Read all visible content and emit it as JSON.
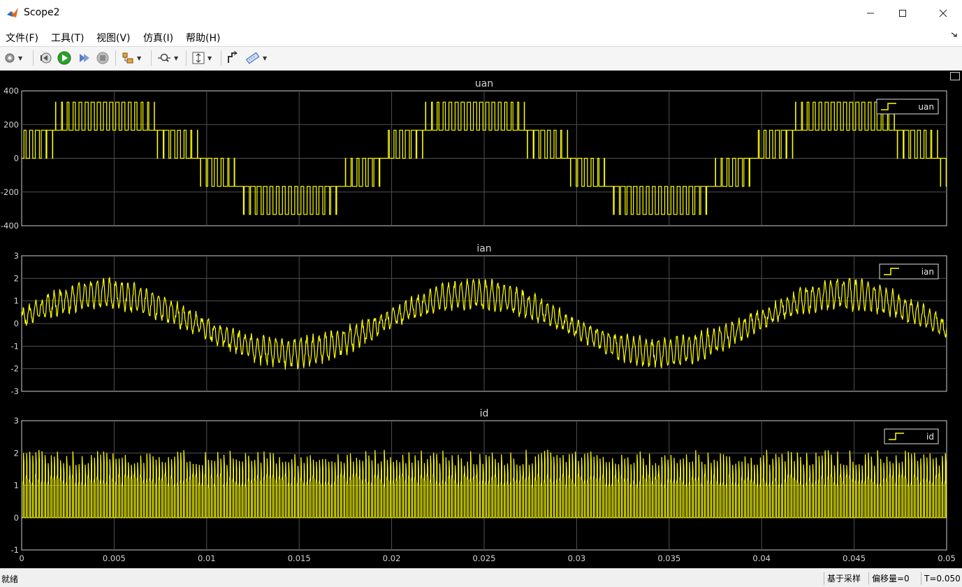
{
  "window": {
    "title": "Scope2",
    "minimize_icon": "minimize-icon",
    "maximize_icon": "maximize-icon",
    "close_icon": "close-icon"
  },
  "menu": {
    "items": [
      "文件(F)",
      "工具(T)",
      "视图(V)",
      "仿真(I)",
      "帮助(H)"
    ]
  },
  "toolbar": {
    "icons": [
      "gear-icon",
      "step-back-icon",
      "run-icon",
      "step-forward-icon",
      "stop-icon",
      "signal-select-icon",
      "zoom-icon",
      "autoscale-icon",
      "highlight-block-icon",
      "measure-icon"
    ]
  },
  "status": {
    "ready": "就绪",
    "sample_based": "基于采样",
    "offset": "偏移量=0",
    "time": "T=0.050"
  },
  "chart_data": [
    {
      "type": "line",
      "title": "uan",
      "legend": [
        "uan"
      ],
      "legend_position": "top-right",
      "ylim": [
        -400,
        400
      ],
      "yticks": [
        "400",
        "200",
        "0",
        "-200",
        "-400"
      ],
      "xlim": [
        0,
        0.05
      ],
      "grid": true,
      "series": [
        {
          "name": "uan",
          "color": "#ffff00",
          "description_levels": [
            -333,
            -167,
            0,
            167,
            333
          ],
          "fundamental_frequency_hz": 50,
          "switching_frequency_hz": 3000
        }
      ]
    },
    {
      "type": "line",
      "title": "ian",
      "legend": [
        "ian"
      ],
      "legend_position": "top-right",
      "ylim": [
        -3,
        3
      ],
      "yticks": [
        "3",
        "2",
        "1",
        "0",
        "-1",
        "-2",
        "-3"
      ],
      "xlim": [
        0,
        0.05
      ],
      "grid": true,
      "series": [
        {
          "name": "ian",
          "color": "#ffff00",
          "amplitude": 1.3,
          "ripple": 0.6,
          "fundamental_frequency_hz": 50,
          "phase_at_zero_deg": 10
        }
      ]
    },
    {
      "type": "line",
      "title": "id",
      "legend": [
        "id"
      ],
      "legend_position": "top-right",
      "ylim": [
        -1,
        3
      ],
      "yticks": [
        "3",
        "2",
        "1",
        "0",
        "-1"
      ],
      "xlim": [
        0,
        0.05
      ],
      "xticks": [
        "0",
        "0.005",
        "0.01",
        "0.015",
        "0.02",
        "0.025",
        "0.03",
        "0.035",
        "0.04",
        "0.045",
        "0.05"
      ],
      "grid": true,
      "series": [
        {
          "name": "id",
          "color": "#ffff00",
          "peak_range": [
            1.6,
            2.1
          ],
          "low_value": 0,
          "switching_frequency_hz": 3000
        }
      ]
    }
  ]
}
